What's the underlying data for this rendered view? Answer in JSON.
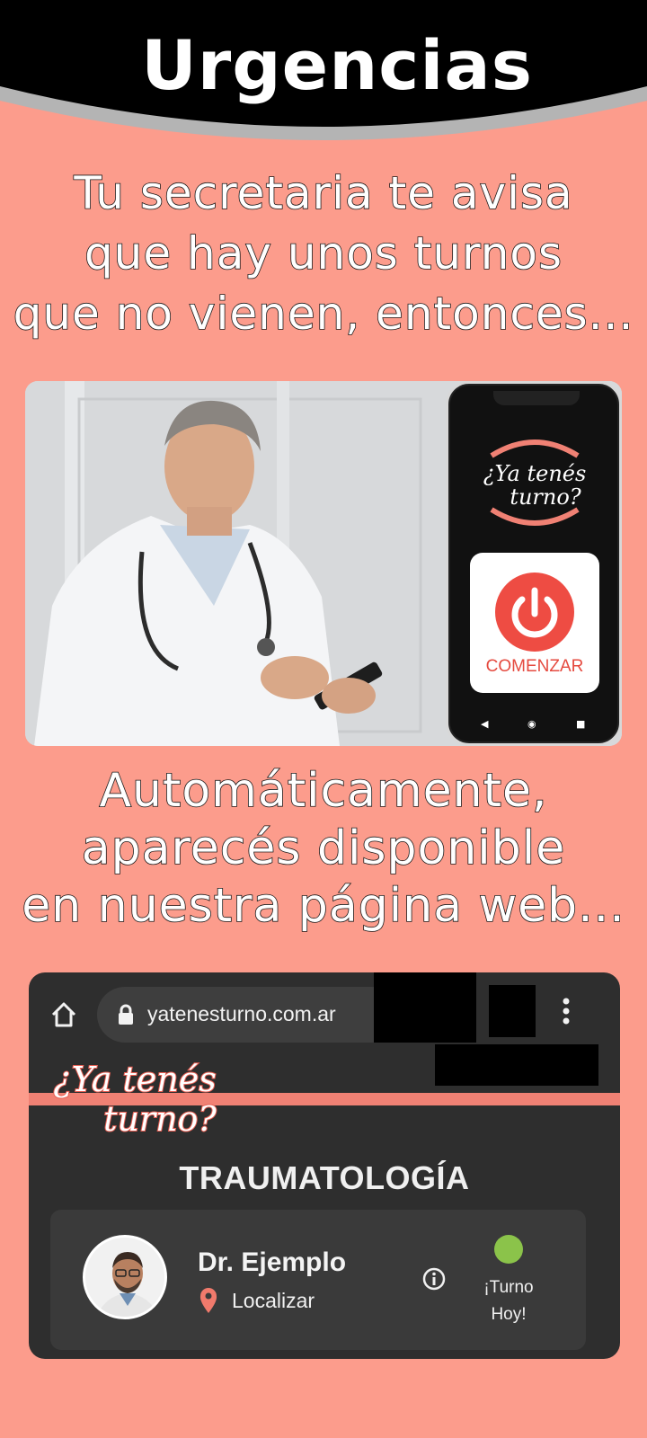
{
  "header": {
    "title": "Urgencias"
  },
  "intro": {
    "lines": [
      "Tu secretaria te avisa",
      "que hay unos turnos",
      "que no vienen, entonces..."
    ]
  },
  "phone": {
    "logo_text_line1": "¿Ya tenés",
    "logo_text_line2": "turno?",
    "start_label": "COMENZAR",
    "nav": {
      "back": "◀",
      "home": "◉",
      "recents": "■"
    }
  },
  "outro": {
    "lines": [
      "Automáticamente,",
      "aparecés disponible",
      "en nuestra página web..."
    ]
  },
  "browser": {
    "url": "yatenesturno.com.ar",
    "brand_line1": "¿Ya tenés",
    "brand_line2": "turno?",
    "specialty": "TRAUMATOLOGÍA",
    "doctor": {
      "name": "Dr. Ejemplo",
      "locate_label": "Localizar",
      "status_line1": "¡Turno",
      "status_line2": "Hoy!"
    }
  },
  "colors": {
    "background": "#fc9c8c",
    "header": "#000000",
    "accent": "#ee4c43",
    "status_available": "#8bc34a",
    "browser_bg": "#2e2e2e"
  },
  "icons": [
    "home-icon",
    "lock-icon",
    "menu-icon",
    "pin-icon",
    "info-icon",
    "power-icon"
  ]
}
